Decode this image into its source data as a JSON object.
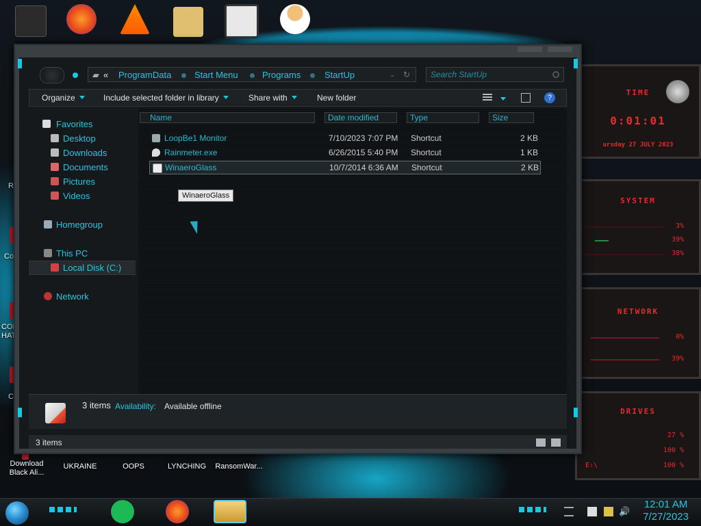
{
  "desktop": {
    "icons": [
      {
        "label": "Download Black Ali..."
      },
      {
        "label": "UKRAINE"
      },
      {
        "label": "OOPS"
      },
      {
        "label": "LYNCHING"
      },
      {
        "label": "RansomWar..."
      }
    ],
    "side_texts": [
      "Re",
      "Cor",
      "COM HAT",
      "Ci"
    ]
  },
  "window": {
    "breadcrumbs": [
      "ProgramData",
      "Start Menu",
      "Programs",
      "StartUp"
    ],
    "breadcrumb_prefix": "«",
    "search_placeholder": "Search StartUp",
    "toolbar": {
      "organize": "Organize",
      "include": "Include selected folder in library",
      "share": "Share with",
      "new_folder": "New folder"
    },
    "nav": {
      "favorites": "Favorites",
      "desktop": "Desktop",
      "downloads": "Downloads",
      "documents": "Documents",
      "pictures": "Pictures",
      "videos": "Videos",
      "homegroup": "Homegroup",
      "this_pc": "This PC",
      "local_disk": "Local Disk (C:)",
      "network": "Network"
    },
    "columns": {
      "name": "Name",
      "date": "Date modified",
      "type": "Type",
      "size": "Size"
    },
    "files": [
      {
        "name": "LoopBe1 Monitor",
        "date": "7/10/2023 7:07 PM",
        "type": "Shortcut",
        "size": "2 KB"
      },
      {
        "name": "Rainmeter.exe",
        "date": "6/26/2015 5:40 PM",
        "type": "Shortcut",
        "size": "1 KB"
      },
      {
        "name": "WinaeroGlass",
        "date": "10/7/2014 6:36 AM",
        "type": "Shortcut",
        "size": "2 KB"
      }
    ],
    "tooltip": "WinaeroGlass",
    "details": {
      "count": "3 items",
      "availability_label": "Availability:",
      "availability_value": "Available offline"
    },
    "status": "3 items"
  },
  "gadgets": {
    "time_title": "TIME",
    "time": "0:01:01",
    "date": "ursday 27 JULY 2023",
    "system_title": "SYSTEM",
    "system_values": [
      "3%",
      "39%",
      "38%"
    ],
    "network_title": "NETWORK",
    "network_values": [
      "0%",
      "39%"
    ],
    "drives_title": "DRIVES",
    "drive_labels": [
      "",
      "",
      "E:\\"
    ],
    "drive_values": [
      "27 %",
      "100 %",
      "100 %"
    ]
  },
  "taskbar": {
    "time": "12:01 AM",
    "date": "7/27/2023"
  },
  "colors": {
    "accent": "#29c5e0",
    "gadget_red": "#e52b2b"
  }
}
